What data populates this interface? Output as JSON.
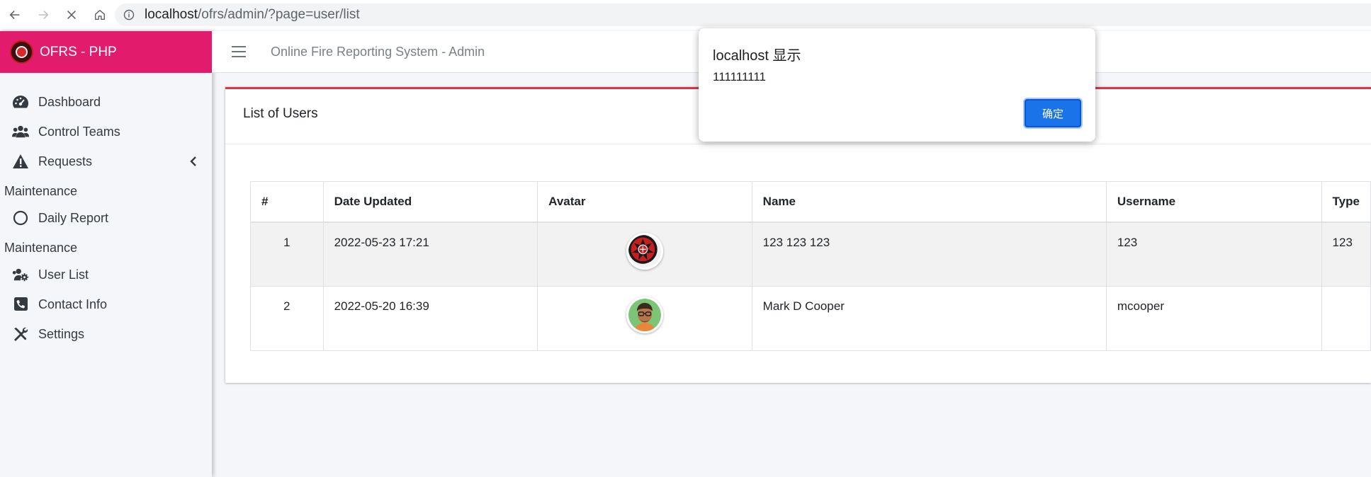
{
  "browser": {
    "url_host": "localhost",
    "url_path": "/ofrs/admin/?page=user/list"
  },
  "brand": {
    "name": "OFRS - PHP"
  },
  "sidebar": {
    "items": [
      {
        "label": "Dashboard",
        "icon": "dashboard-icon"
      },
      {
        "label": "Control Teams",
        "icon": "users-icon"
      },
      {
        "label": "Requests",
        "icon": "warning-icon"
      }
    ],
    "section1": "Maintenance",
    "section1_items": [
      {
        "label": "Daily Report",
        "icon": "circle-icon"
      }
    ],
    "section2": "Maintenance",
    "section2_items": [
      {
        "label": "User List",
        "icon": "users-cog-icon"
      },
      {
        "label": "Contact Info",
        "icon": "phone-square-icon"
      },
      {
        "label": "Settings",
        "icon": "tools-icon"
      }
    ]
  },
  "topbar": {
    "title": "Online Fire Reporting System - Admin"
  },
  "card": {
    "title": "List of Users"
  },
  "table": {
    "headers": [
      "#",
      "Date Updated",
      "Avatar",
      "Name",
      "Username",
      "Type"
    ],
    "rows": [
      {
        "num": "1",
        "date": "2022-05-23 17:21",
        "avatar": "fire-logo-avatar",
        "name": "123 123 123",
        "username": "123",
        "type": "123"
      },
      {
        "num": "2",
        "date": "2022-05-20 16:39",
        "avatar": "man-avatar",
        "name": "Mark D Cooper",
        "username": "mcooper",
        "type": ""
      }
    ]
  },
  "dialog": {
    "title": "localhost 显示",
    "message": "111111111",
    "ok_label": "确定"
  },
  "colors": {
    "brand": "#e31b6d",
    "card_accent": "#dc3545",
    "dialog_button": "#1a73e8"
  }
}
